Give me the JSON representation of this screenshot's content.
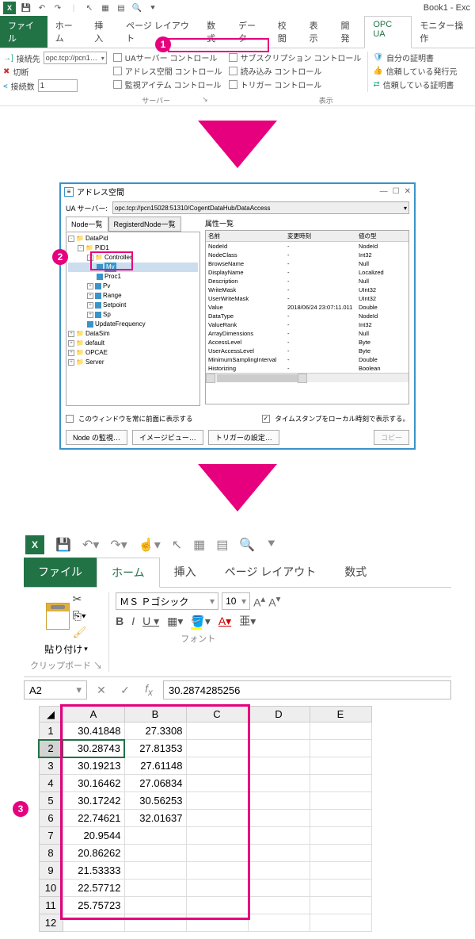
{
  "qat": {
    "title": "Book1 - Exc"
  },
  "tabs": {
    "file": "ファイル",
    "home": "ホーム",
    "insert": "挿入",
    "layout": "ページ レイアウト",
    "formula": "数式",
    "data": "データ",
    "review": "校閲",
    "view": "表示",
    "dev": "開発",
    "opcua": "OPC UA",
    "monitor": "モニター操作"
  },
  "ribbon": {
    "connect_to": "接続先",
    "disconnect": "切断",
    "connect_count": "接続数",
    "server_url": "opc.tcp://pcn1…",
    "count": "1",
    "ua_server": "UAサーバー コントロール",
    "addr_space": "アドレス空間 コントロール",
    "watch_items": "監視アイテム コントロール",
    "subscription": "サブスクリプション コントロール",
    "read": "読み込み コントロール",
    "trigger": "トリガー コントロール",
    "own_cert": "自分の証明書",
    "trusted_issuer": "信頼している発行元",
    "trusted_cert": "信頼している証明書",
    "group_server": "サーバー",
    "group_view": "表示"
  },
  "dialog": {
    "title": "アドレス空間",
    "server_label": "UA サーバー:",
    "server_value": "opc.tcp://pcn15028:51310/CogentDataHub/DataAccess",
    "left_tab1": "Node一覧",
    "left_tab2": "RegisterdNode一覧",
    "right_header": "属性一覧",
    "tree": [
      "DataPid",
      "PID1",
      "Controller",
      "Mv",
      "Proc1",
      "Pv",
      "Range",
      "Setpoint",
      "Sp",
      "UpdateFrequency",
      "DataSim",
      "default",
      "OPCAE",
      "Server"
    ],
    "attr_head": {
      "c1": "名前",
      "c2": "変更時刻",
      "c3": "値の型"
    },
    "attrs": [
      {
        "n": "NodeId",
        "t": "-",
        "v": "NodeId"
      },
      {
        "n": "NodeClass",
        "t": "-",
        "v": "Int32"
      },
      {
        "n": "BrowseName",
        "t": "-",
        "v": "Null"
      },
      {
        "n": "DisplayName",
        "t": "-",
        "v": "Localized"
      },
      {
        "n": "Description",
        "t": "-",
        "v": "Null"
      },
      {
        "n": "WriteMask",
        "t": "-",
        "v": "UInt32"
      },
      {
        "n": "UserWriteMask",
        "t": "-",
        "v": "UInt32"
      },
      {
        "n": "Value",
        "t": "2018/06/24 23:07:11.011",
        "v": "Double"
      },
      {
        "n": "DataType",
        "t": "-",
        "v": "NodeId"
      },
      {
        "n": "ValueRank",
        "t": "-",
        "v": "Int32"
      },
      {
        "n": "ArrayDimensions",
        "t": "-",
        "v": "Null"
      },
      {
        "n": "AccessLevel",
        "t": "-",
        "v": "Byte"
      },
      {
        "n": "UserAccessLevel",
        "t": "-",
        "v": "Byte"
      },
      {
        "n": "MinimumSamplingInterval",
        "t": "-",
        "v": "Double"
      },
      {
        "n": "Historizing",
        "t": "-",
        "v": "Boolean"
      }
    ],
    "chk_always_front": "このウィンドウを常に前面に表示する",
    "chk_local_ts": "タイムスタンプをローカル時刻で表示する。",
    "btn_watch": "Node の監視…",
    "btn_image": "イメージビュー…",
    "btn_trigger": "トリガーの設定…",
    "btn_copy": "コピー"
  },
  "excel3": {
    "tabs": {
      "file": "ファイル",
      "home": "ホーム",
      "insert": "挿入",
      "layout": "ページ レイアウト",
      "formula": "数式"
    },
    "clipboard": "クリップボード",
    "paste": "貼り付け",
    "font_group": "フォント",
    "font_name": "ＭＳ Ｐゴシック",
    "font_size": "10",
    "namebox": "A2",
    "formula": "30.2874285256",
    "cols": [
      "A",
      "B",
      "C",
      "D",
      "E"
    ],
    "rows": [
      {
        "r": "1",
        "a": "30.41848",
        "b": "27.3308"
      },
      {
        "r": "2",
        "a": "30.28743",
        "b": "27.81353"
      },
      {
        "r": "3",
        "a": "30.19213",
        "b": "27.61148"
      },
      {
        "r": "4",
        "a": "30.16462",
        "b": "27.06834"
      },
      {
        "r": "5",
        "a": "30.17242",
        "b": "30.56253"
      },
      {
        "r": "6",
        "a": "22.74621",
        "b": "32.01637"
      },
      {
        "r": "7",
        "a": "20.9544",
        "b": ""
      },
      {
        "r": "8",
        "a": "20.86262",
        "b": ""
      },
      {
        "r": "9",
        "a": "21.53333",
        "b": ""
      },
      {
        "r": "10",
        "a": "22.57712",
        "b": ""
      },
      {
        "r": "11",
        "a": "25.75723",
        "b": ""
      },
      {
        "r": "12",
        "a": "",
        "b": ""
      }
    ]
  }
}
